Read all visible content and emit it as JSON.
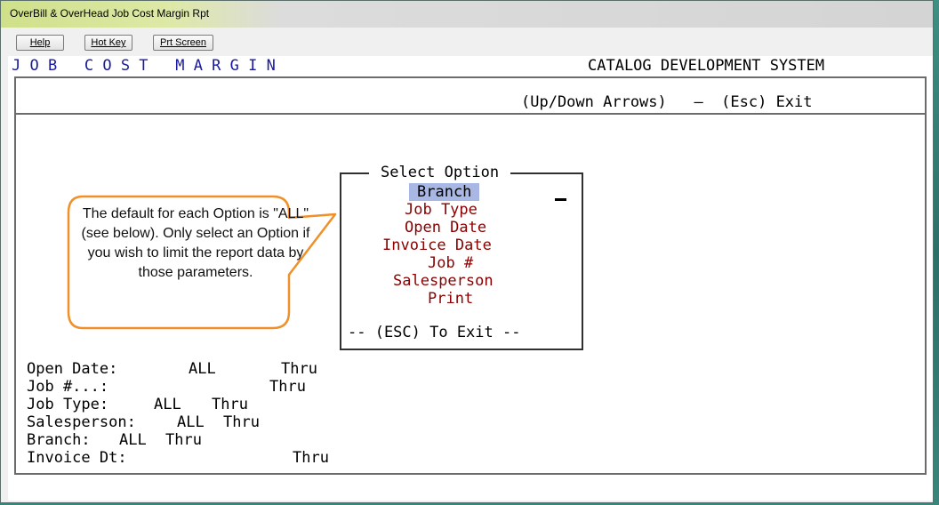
{
  "window": {
    "title": "OverBill & OverHead Job Cost Margin Rpt"
  },
  "toolbar": {
    "help_label": "Help",
    "hotkey_label": "Hot Key",
    "prtscreen_label": "Prt Screen"
  },
  "header": {
    "left_title": "J O B   C O S T   M A R G I N",
    "right_title": "CATALOG DEVELOPMENT SYSTEM"
  },
  "nav_hint": "(Up/Down Arrows)   –  (Esc) Exit",
  "option_box": {
    "title": "Select Option",
    "items": [
      {
        "label": "Branch",
        "selected": true
      },
      {
        "label": "Job Type",
        "selected": false
      },
      {
        "label": "Open Date",
        "selected": false
      },
      {
        "label": "Invoice Date",
        "selected": false
      },
      {
        "label": "Job #",
        "selected": false
      },
      {
        "label": "Salesperson",
        "selected": false
      },
      {
        "label": "Print",
        "selected": false
      }
    ],
    "footer": "-- (ESC) To Exit --"
  },
  "callout": {
    "text": "The default for each Option is \"ALL\" (see below). Only select an Option if you wish to limit the report data by those parameters.",
    "border_color": "#f0902a"
  },
  "filters": [
    {
      "label": "Open Date:",
      "value": "ALL",
      "thru": "Thru"
    },
    {
      "label": "Job #...:",
      "value": "",
      "thru": "Thru"
    },
    {
      "label": "Job Type:",
      "value": "ALL",
      "thru": "Thru"
    },
    {
      "label": "Salesperson:",
      "value": "ALL",
      "thru": "Thru"
    },
    {
      "label": "Branch:",
      "value": "ALL",
      "thru": "Thru"
    },
    {
      "label": "Invoice Dt:",
      "value": "",
      "thru": "Thru"
    }
  ],
  "colors": {
    "header_left": "#1a1aa0",
    "option_item": "#8b0000",
    "option_selected_bg": "#a9b7e4"
  }
}
